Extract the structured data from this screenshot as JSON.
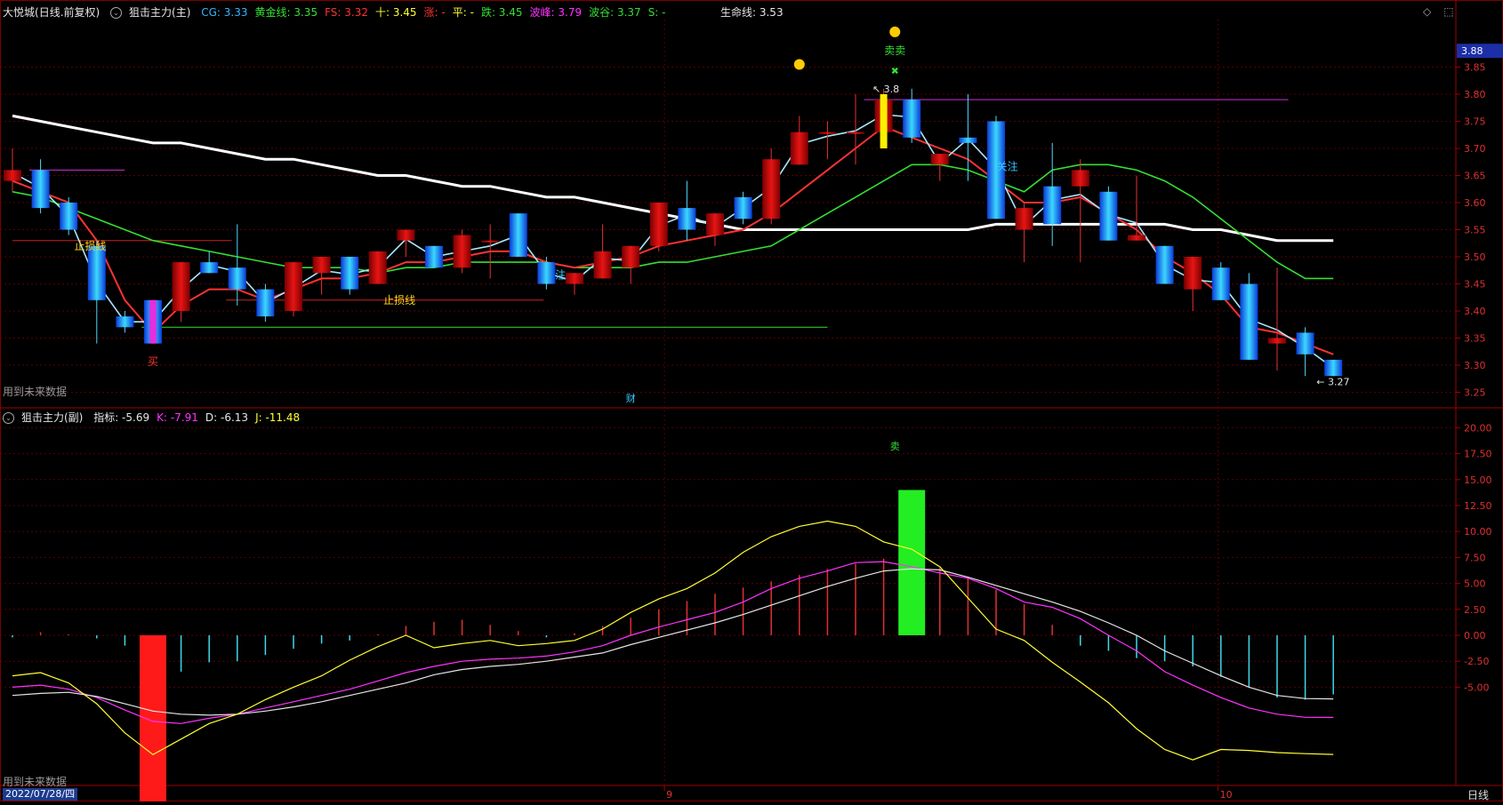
{
  "main_header": {
    "stock": "大悦城",
    "mode": "(日线.前复权)",
    "indicator": "狙击主力(主)",
    "items": [
      {
        "label": "CG:",
        "value": "3.33",
        "color": "#35b7ff"
      },
      {
        "label": "黄金线:",
        "value": "3.35",
        "color": "#33e033"
      },
      {
        "label": "FS:",
        "value": "3.32",
        "color": "#ff3232"
      },
      {
        "label": "十:",
        "value": "3.45",
        "color": "#ffff33"
      },
      {
        "label": "涨:",
        "value": "-",
        "color": "#ff3232"
      },
      {
        "label": "平:",
        "value": "-",
        "color": "#ffff33"
      },
      {
        "label": "跌:",
        "value": "3.45",
        "color": "#33e033"
      },
      {
        "label": "波峰:",
        "value": "3.79",
        "color": "#ff33ff"
      },
      {
        "label": "波谷:",
        "value": "3.37",
        "color": "#33e033"
      },
      {
        "label": "S:",
        "value": "-",
        "color": "#33e033"
      }
    ],
    "life_line": "生命线: 3.53"
  },
  "sub_header": {
    "indicator": "狙击主力(副)",
    "items": [
      {
        "label": "指标:",
        "value": "-5.69",
        "color": "#e6e6e6"
      },
      {
        "label": "K:",
        "value": "-7.91",
        "color": "#ff33ff"
      },
      {
        "label": "D:",
        "value": "-6.13",
        "color": "#e6e6e6"
      },
      {
        "label": "J:",
        "value": "-11.48",
        "color": "#ffff33"
      }
    ]
  },
  "future_data_warning": "用到未来数据",
  "bottom": {
    "start_date": "2022/07/28/四",
    "period": "日线",
    "month_labels": [
      "9",
      "10"
    ]
  },
  "price_scale_current": "3.88",
  "chart_data": [
    {
      "type": "candlestick",
      "panel": "main",
      "ylim": [
        3.2,
        3.9
      ],
      "y_ticks": [
        "3.85",
        "3.80",
        "3.75",
        "3.70",
        "3.65",
        "3.60",
        "3.55",
        "3.50",
        "3.45",
        "3.40",
        "3.35",
        "3.30",
        "3.25"
      ],
      "candles": [
        {
          "o": 3.64,
          "h": 3.7,
          "l": 3.62,
          "c": 3.66
        },
        {
          "o": 3.66,
          "h": 3.68,
          "l": 3.58,
          "c": 3.59
        },
        {
          "o": 3.6,
          "h": 3.61,
          "l": 3.54,
          "c": 3.55
        },
        {
          "o": 3.52,
          "h": 3.53,
          "l": 3.34,
          "c": 3.42
        },
        {
          "o": 3.39,
          "h": 3.4,
          "l": 3.36,
          "c": 3.37
        },
        {
          "o": 3.42,
          "h": 3.42,
          "l": 3.34,
          "c": 3.34
        },
        {
          "o": 3.4,
          "h": 3.49,
          "l": 3.38,
          "c": 3.49
        },
        {
          "o": 3.49,
          "h": 3.51,
          "l": 3.47,
          "c": 3.47
        },
        {
          "o": 3.48,
          "h": 3.56,
          "l": 3.41,
          "c": 3.44
        },
        {
          "o": 3.44,
          "h": 3.45,
          "l": 3.38,
          "c": 3.39
        },
        {
          "o": 3.4,
          "h": 3.49,
          "l": 3.39,
          "c": 3.49
        },
        {
          "o": 3.47,
          "h": 3.5,
          "l": 3.43,
          "c": 3.5
        },
        {
          "o": 3.5,
          "h": 3.5,
          "l": 3.43,
          "c": 3.44
        },
        {
          "o": 3.45,
          "h": 3.51,
          "l": 3.45,
          "c": 3.51
        },
        {
          "o": 3.53,
          "h": 3.55,
          "l": 3.5,
          "c": 3.55
        },
        {
          "o": 3.52,
          "h": 3.52,
          "l": 3.48,
          "c": 3.48
        },
        {
          "o": 3.48,
          "h": 3.55,
          "l": 3.47,
          "c": 3.54
        },
        {
          "o": 3.53,
          "h": 3.56,
          "l": 3.46,
          "c": 3.53
        },
        {
          "o": 3.58,
          "h": 3.58,
          "l": 3.5,
          "c": 3.5
        },
        {
          "o": 3.49,
          "h": 3.5,
          "l": 3.44,
          "c": 3.45
        },
        {
          "o": 3.45,
          "h": 3.47,
          "l": 3.43,
          "c": 3.47
        },
        {
          "o": 3.46,
          "h": 3.56,
          "l": 3.46,
          "c": 3.51
        },
        {
          "o": 3.48,
          "h": 3.52,
          "l": 3.45,
          "c": 3.52
        },
        {
          "o": 3.52,
          "h": 3.6,
          "l": 3.51,
          "c": 3.6
        },
        {
          "o": 3.59,
          "h": 3.64,
          "l": 3.53,
          "c": 3.55
        },
        {
          "o": 3.54,
          "h": 3.58,
          "l": 3.52,
          "c": 3.58
        },
        {
          "o": 3.61,
          "h": 3.62,
          "l": 3.56,
          "c": 3.57
        },
        {
          "o": 3.57,
          "h": 3.7,
          "l": 3.56,
          "c": 3.68
        },
        {
          "o": 3.67,
          "h": 3.76,
          "l": 3.67,
          "c": 3.73
        },
        {
          "o": 3.73,
          "h": 3.75,
          "l": 3.68,
          "c": 3.73
        },
        {
          "o": 3.73,
          "h": 3.8,
          "l": 3.67,
          "c": 3.73
        },
        {
          "o": 3.73,
          "h": 3.81,
          "l": 3.72,
          "c": 3.79
        },
        {
          "o": 3.79,
          "h": 3.81,
          "l": 3.71,
          "c": 3.72
        },
        {
          "o": 3.67,
          "h": 3.69,
          "l": 3.64,
          "c": 3.69
        },
        {
          "o": 3.72,
          "h": 3.8,
          "l": 3.64,
          "c": 3.71
        },
        {
          "o": 3.75,
          "h": 3.76,
          "l": 3.57,
          "c": 3.57
        },
        {
          "o": 3.55,
          "h": 3.6,
          "l": 3.49,
          "c": 3.59
        },
        {
          "o": 3.63,
          "h": 3.71,
          "l": 3.52,
          "c": 3.56
        },
        {
          "o": 3.63,
          "h": 3.68,
          "l": 3.49,
          "c": 3.66
        },
        {
          "o": 3.62,
          "h": 3.63,
          "l": 3.53,
          "c": 3.53
        },
        {
          "o": 3.53,
          "h": 3.65,
          "l": 3.53,
          "c": 3.54
        },
        {
          "o": 3.52,
          "h": 3.52,
          "l": 3.45,
          "c": 3.45
        },
        {
          "o": 3.44,
          "h": 3.49,
          "l": 3.4,
          "c": 3.5
        },
        {
          "o": 3.48,
          "h": 3.49,
          "l": 3.42,
          "c": 3.42
        },
        {
          "o": 3.45,
          "h": 3.47,
          "l": 3.31,
          "c": 3.31
        },
        {
          "o": 3.34,
          "h": 3.48,
          "l": 3.29,
          "c": 3.35
        },
        {
          "o": 3.36,
          "h": 3.37,
          "l": 3.28,
          "c": 3.32
        },
        {
          "o": 3.31,
          "h": 3.31,
          "l": 3.28,
          "c": 3.28
        }
      ],
      "lines": [
        {
          "name": "生命线",
          "color": "#ffffff",
          "values": [
            3.76,
            3.75,
            3.74,
            3.73,
            3.72,
            3.71,
            3.71,
            3.7,
            3.69,
            3.68,
            3.68,
            3.67,
            3.66,
            3.65,
            3.65,
            3.64,
            3.63,
            3.63,
            3.62,
            3.61,
            3.61,
            3.6,
            3.59,
            3.58,
            3.57,
            3.56,
            3.55,
            3.55,
            3.55,
            3.55,
            3.55,
            3.55,
            3.55,
            3.55,
            3.55,
            3.56,
            3.56,
            3.56,
            3.56,
            3.56,
            3.56,
            3.56,
            3.55,
            3.55,
            3.54,
            3.53,
            3.53,
            3.53
          ]
        },
        {
          "name": "黄金线",
          "color": "#33e033",
          "values": [
            3.62,
            3.61,
            3.59,
            3.57,
            3.55,
            3.53,
            3.52,
            3.51,
            3.5,
            3.49,
            3.48,
            3.48,
            3.48,
            3.47,
            3.48,
            3.48,
            3.49,
            3.49,
            3.49,
            3.49,
            3.48,
            3.48,
            3.48,
            3.49,
            3.49,
            3.5,
            3.51,
            3.52,
            3.55,
            3.58,
            3.61,
            3.64,
            3.67,
            3.67,
            3.66,
            3.64,
            3.62,
            3.66,
            3.67,
            3.67,
            3.66,
            3.64,
            3.61,
            3.57,
            3.53,
            3.49,
            3.46,
            3.46
          ]
        },
        {
          "name": "FS",
          "color": "#ff3232",
          "values": [
            3.64,
            3.62,
            3.6,
            3.53,
            3.42,
            3.36,
            3.41,
            3.44,
            3.44,
            3.42,
            3.44,
            3.46,
            3.46,
            3.47,
            3.49,
            3.49,
            3.5,
            3.51,
            3.51,
            3.49,
            3.48,
            3.49,
            3.5,
            3.52,
            3.53,
            3.54,
            3.55,
            3.58,
            3.62,
            3.66,
            3.7,
            3.74,
            3.72,
            3.7,
            3.68,
            3.64,
            3.6,
            3.6,
            3.61,
            3.58,
            3.55,
            3.5,
            3.47,
            3.43,
            3.37,
            3.36,
            3.34,
            3.32
          ]
        }
      ],
      "annotations": [
        {
          "text": "止损线",
          "color": "#ffd21e"
        },
        {
          "text": "止损线",
          "color": "#ffd21e"
        },
        {
          "text": "买",
          "color": "#ff3232"
        },
        {
          "text": "关注",
          "color": "#37c8ff"
        },
        {
          "text": "注",
          "color": "#37c8ff"
        },
        {
          "text": "卖卖",
          "color": "#33e033"
        },
        {
          "text": "3.8",
          "color": "#e6e6e6"
        },
        {
          "text": "3.27",
          "color": "#e6e6e6"
        },
        {
          "text": "财",
          "color": "#37c8ff"
        }
      ]
    },
    {
      "type": "bar+line",
      "panel": "sub",
      "ylim": [
        -20,
        22
      ],
      "y_ticks": [
        "20.00",
        "17.50",
        "15.00",
        "12.50",
        "10.00",
        "7.50",
        "5.00",
        "2.50",
        "0.00",
        "-2.50",
        "-5.00"
      ],
      "bars": [
        -0.2,
        0.3,
        0.1,
        -0.3,
        -1.0,
        -2.6,
        -3.5,
        -2.6,
        -2.5,
        -1.9,
        -1.3,
        -0.8,
        -0.5,
        0.1,
        0.9,
        1.3,
        1.5,
        1.0,
        0.4,
        -0.2,
        0.2,
        0.9,
        1.7,
        2.5,
        3.3,
        4.0,
        4.6,
        5.2,
        5.8,
        6.4,
        6.9,
        7.4,
        7.1,
        6.5,
        5.5,
        4.4,
        3.0,
        1.0,
        -1.0,
        -1.5,
        -2.2,
        -2.5,
        -3.0,
        -4.0,
        -5.0,
        -6.0,
        -6.2,
        -5.69
      ],
      "signal_bars": [
        {
          "index": 5,
          "from": 0,
          "to": -19.5,
          "color": "#ff1a1a"
        },
        {
          "index": 32,
          "from": 0,
          "to": 14.0,
          "color": "#22ee22"
        }
      ],
      "lines": [
        {
          "name": "K",
          "color": "#ff33ff",
          "values": [
            -5.0,
            -4.8,
            -5.2,
            -6.0,
            -7.2,
            -8.3,
            -8.5,
            -8.0,
            -7.6,
            -7.0,
            -6.4,
            -5.8,
            -5.2,
            -4.4,
            -3.6,
            -3.0,
            -2.5,
            -2.3,
            -2.2,
            -2.0,
            -1.6,
            -1.0,
            0.0,
            0.8,
            1.5,
            2.2,
            3.2,
            4.5,
            5.5,
            6.2,
            7.0,
            7.1,
            6.6,
            6.0,
            5.5,
            4.5,
            3.2,
            2.7,
            1.6,
            0.0,
            -1.5,
            -3.5,
            -4.8,
            -6.0,
            -7.0,
            -7.6,
            -7.9,
            -7.91
          ]
        },
        {
          "name": "D",
          "color": "#e6e6e6",
          "values": [
            -5.8,
            -5.6,
            -5.5,
            -5.9,
            -6.6,
            -7.3,
            -7.6,
            -7.7,
            -7.6,
            -7.3,
            -6.9,
            -6.4,
            -5.8,
            -5.2,
            -4.6,
            -3.8,
            -3.3,
            -3.0,
            -2.8,
            -2.5,
            -2.1,
            -1.7,
            -0.9,
            -0.2,
            0.5,
            1.2,
            2.0,
            2.9,
            3.8,
            4.7,
            5.5,
            6.2,
            6.4,
            6.3,
            5.6,
            4.8,
            4.0,
            3.2,
            2.3,
            1.2,
            0.0,
            -1.5,
            -2.7,
            -3.9,
            -5.0,
            -5.8,
            -6.1,
            -6.13
          ]
        },
        {
          "name": "J",
          "color": "#ffff33",
          "values": [
            -3.9,
            -3.6,
            -4.6,
            -6.6,
            -9.4,
            -11.5,
            -10.0,
            -8.5,
            -7.6,
            -6.2,
            -5.0,
            -3.9,
            -2.4,
            -1.1,
            0.0,
            -1.2,
            -0.8,
            -0.5,
            -1.0,
            -0.8,
            -0.5,
            0.6,
            2.2,
            3.5,
            4.5,
            6.0,
            8.0,
            9.5,
            10.5,
            11.0,
            10.5,
            9.0,
            8.3,
            6.6,
            3.6,
            0.6,
            -0.5,
            -2.6,
            -4.5,
            -6.5,
            -9.0,
            -11.0,
            -12.0,
            -11.0,
            -11.1,
            -11.3,
            -11.4,
            -11.48
          ]
        }
      ]
    }
  ]
}
